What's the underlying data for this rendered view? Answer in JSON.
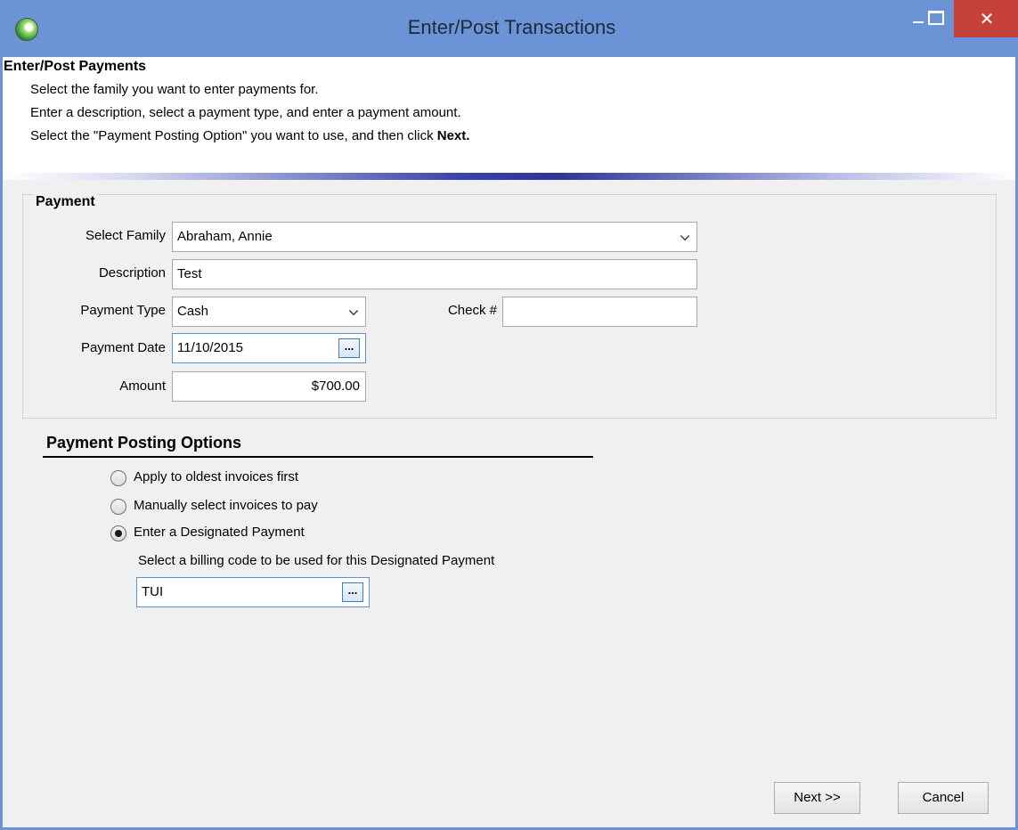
{
  "window": {
    "title": "Enter/Post Transactions"
  },
  "header": {
    "title": "Enter/Post Payments",
    "line1": "Select the family you want to enter payments for.",
    "line2": "Enter a description, select a payment type, and enter a payment amount.",
    "line3_prefix": "Select the \"Payment Posting Option\" you want to use, and then click ",
    "line3_bold": "Next."
  },
  "payment": {
    "group_title": "Payment",
    "family_label": "Select Family",
    "family_value": "Abraham, Annie",
    "description_label": "Description",
    "description_value": "Test",
    "payment_type_label": "Payment Type",
    "payment_type_value": "Cash",
    "check_label": "Check #",
    "check_value": "",
    "payment_date_label": "Payment Date",
    "payment_date_value": "11/10/2015",
    "amount_label": "Amount",
    "amount_value": "$700.00",
    "ellipsis": "..."
  },
  "posting_options": {
    "title": "Payment Posting Options",
    "options": [
      {
        "label": "Apply to oldest invoices first",
        "checked": false
      },
      {
        "label": "Manually select invoices to pay",
        "checked": false
      },
      {
        "label": "Enter a Designated Payment",
        "checked": true
      }
    ],
    "billing_code_label": "Select a billing code to be used for this Designated Payment",
    "billing_code_value": "TUI"
  },
  "buttons": {
    "next": "Next >>",
    "cancel": "Cancel"
  }
}
